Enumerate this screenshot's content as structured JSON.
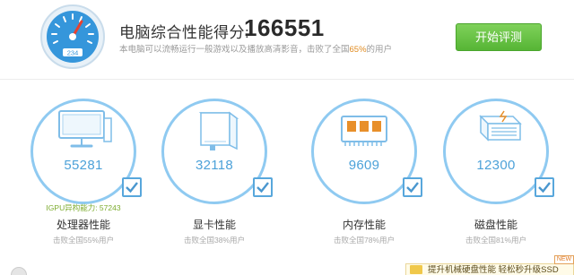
{
  "header": {
    "score_label": "电脑综合性能得分:",
    "score_value": "166551",
    "gauge_reading": "234",
    "description_prefix": "本电脑可以流畅运行一般游戏以及播放高清影音，击败了全国",
    "description_percent": "65%",
    "description_suffix": "的用户",
    "start_button": "开始评测"
  },
  "cards": [
    {
      "id": "cpu",
      "score": "55281",
      "name": "处理器性能",
      "beat": "击败全国55%用户",
      "igpu": "IGPU异构能力: 57243",
      "icon": "monitor-icon"
    },
    {
      "id": "gpu",
      "score": "32118",
      "name": "显卡性能",
      "beat": "击败全国38%用户",
      "icon": "graphics-card-icon"
    },
    {
      "id": "memory",
      "score": "9609",
      "name": "内存性能",
      "beat": "击败全国78%用户",
      "icon": "memory-chip-icon"
    },
    {
      "id": "disk",
      "score": "12300",
      "name": "磁盘性能",
      "beat": "击败全国81%用户",
      "icon": "disk-drive-icon"
    }
  ],
  "footer": {
    "promo_text": "提升机械硬盘性能  轻松秒升级SSD",
    "new_badge": "NEW"
  },
  "colors": {
    "accent_blue": "#4da2d9",
    "ring_blue": "#8fcaf1",
    "button_green": "#56b535",
    "percent_orange": "#e08a1e",
    "igpu_green": "#7cab2e"
  }
}
